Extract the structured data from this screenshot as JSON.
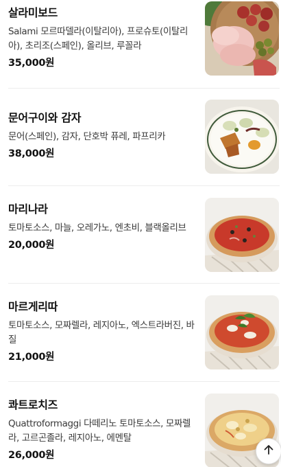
{
  "menu": {
    "items": [
      {
        "name": "살라미보드",
        "description": "Salami 모르따델라(이탈리아), 프로슈토(이탈리아), 초리조(스페인), 올리브, 루꼴라",
        "price": "35,000원",
        "image_icon": "charcuterie-board-photo"
      },
      {
        "name": "문어구이와 감자",
        "description": "문어(스페인), 감자, 단호박 퓨레, 파프리카",
        "price": "38,000원",
        "image_icon": "grilled-octopus-plate-photo"
      },
      {
        "name": "마리나라",
        "description": "토마토소스, 마늘, 오레가노, 엔초비, 블랙올리브",
        "price": "20,000원",
        "image_icon": "marinara-pizza-photo"
      },
      {
        "name": "마르게리따",
        "description": "토마토소스, 모짜렐라, 레지아노, 엑스트라버진, 바질",
        "price": "21,000원",
        "image_icon": "margherita-pizza-photo"
      },
      {
        "name": "콰트로치즈",
        "description": "Quattroformaggi 다떼리노 토마토소스, 모짜렐라, 고르곤졸라, 레지아노, 에멘탈",
        "price": "26,000원",
        "image_icon": "quattro-cheese-pizza-photo"
      }
    ]
  },
  "scroll_top_icon": "arrow-up-icon"
}
